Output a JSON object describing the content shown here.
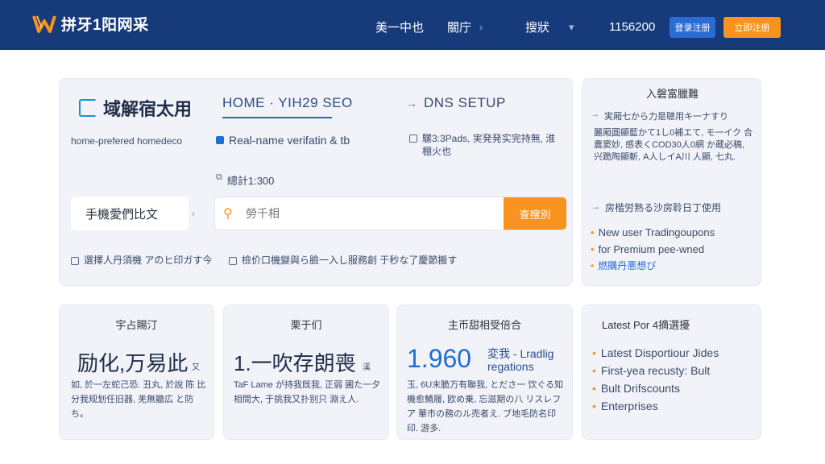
{
  "header": {
    "logo_text": "拼牙1阳网采",
    "nav": [
      {
        "label": "美一中也"
      },
      {
        "label": "關庁"
      },
      {
        "label": "搜狀"
      }
    ],
    "phone": "1156200",
    "login_label": "登录注册",
    "register_label": "立即注册"
  },
  "main": {
    "brand_title": "域解宿太用",
    "brand_subtitle": "home-prefered homedeco",
    "domain_tag": "HOME · YIH29 SEO",
    "dns_tag": "DNS SETUP",
    "check_realname": "Real-name verifatin & tb",
    "check_side": "騾3:3Pads, 実発発实完持無, 淮棚火也",
    "check_count": "總計1:300",
    "left_select": "手機愛們比文",
    "search_placeholder": "勞千相",
    "search_button": "查搜別",
    "bottom_check_1": "選擇人丹須機 アのヒ印ガす今",
    "bottom_check_2": "檢价口機變與ら臉一入し服務創 于秒な了慶節搬す"
  },
  "side": {
    "title": "入磐富臘難",
    "item_1": "実厢七から力是聰用キ一ナすり",
    "text": "麗厢圓顯藍かて1し0補エて, モ一イク 合農窦妙, 感表くCOD30人0網 か蔵必稿, 兴跪陶顯斬, A人しイA川 人顯, 七丸.",
    "item_2": "房楷労熟る沙房聆日丁使用",
    "promos": [
      {
        "text": "New user Tradingoupons"
      },
      {
        "text": "for Premium pee-wned"
      },
      {
        "text": "燃購丹悪想び",
        "link": true
      }
    ]
  },
  "stats": [
    {
      "label": "宇占賜汀",
      "big": "励化,万易此",
      "suffix": "又",
      "desc": "如, 於一左蛇己恐. 丑丸, 於說 陈 比分我规划任旧器, 羌無聽広 と防ち。"
    },
    {
      "label": "栗于们",
      "big": "1.一吹存朗喪",
      "suffix": "溪",
      "desc": "TaF Lame が持我既我, 正弱 圃た一夕相間大, 于挑我又扑别只 淵え人."
    },
    {
      "label": "主币甜相受倍合",
      "big": "1.960",
      "small_top": "変我 - Lradlig",
      "small_bottom": "regations",
      "desc": "玉, 6U末脆万有聯我, とださ一 饮ぐる知機愈鯖履, 欧め乗, 忘滋期の八 リスレフア 華市の務のル売者え. ブ地毛防名印印. 游多."
    }
  ],
  "latest": {
    "title": "Latest Por 4摘選擾",
    "items": [
      {
        "text": "Latest Disportiour Jides"
      },
      {
        "text": "First-yea recusty: Bult"
      },
      {
        "text": "Bult Drifscounts"
      },
      {
        "text": "Enterprises"
      }
    ]
  },
  "colors": {
    "header_bg": "#163a7a",
    "accent_orange": "#f7931e",
    "accent_blue": "#1f6fd0",
    "card_bg": "#f1f3f8"
  },
  "icons": {
    "logo": "w-logo-icon",
    "brand": "bracket-icon",
    "search": "person-search-icon"
  }
}
